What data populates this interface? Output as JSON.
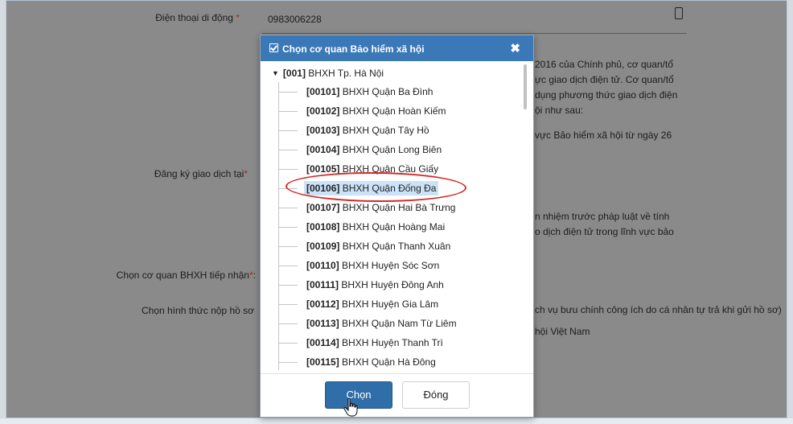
{
  "form": {
    "phone": {
      "label": "Điện thoại di động",
      "required_mark": "*",
      "value": "0983006228"
    },
    "register": {
      "label": "Đăng ký giao dịch tại",
      "required_mark": "*"
    },
    "agency": {
      "label": "Chọn cơ quan BHXH tiếp nhận",
      "required_mark": "*",
      "suffix": ":"
    },
    "submit_method": {
      "label": "Chọn hình thức nộp hồ sơ"
    }
  },
  "background_text": {
    "line1": "2016 của Chính phủ, cơ quan/tổ",
    "line2": "ực giao dịch điện tử. Cơ quan/tổ",
    "line3": "dụng phương thức giao dịch điện",
    "line4": "ội như sau:",
    "line5": "vực Bảo hiểm xã hội từ ngày 26",
    "line6": "n nhiệm trước pháp luật về tính",
    "line7": "o dịch điện tử trong lĩnh vực bảo",
    "line8": "ch vụ bưu chính công ích do cá nhân tự trả khi gửi hồ sơ)",
    "line9": "hội Việt Nam"
  },
  "modal": {
    "title": "Chọn cơ quan Bảo hiểm xã hội",
    "close_symbol": "✖",
    "root": {
      "code": "[001]",
      "name": "BHXH Tp. Hà Nội"
    },
    "items": [
      {
        "code": "[00101]",
        "name": "BHXH Quận Ba Đình"
      },
      {
        "code": "[00102]",
        "name": "BHXH Quận Hoàn Kiếm"
      },
      {
        "code": "[00103]",
        "name": "BHXH Quận Tây Hồ"
      },
      {
        "code": "[00104]",
        "name": "BHXH Quận Long Biên"
      },
      {
        "code": "[00105]",
        "name": "BHXH Quận Cầu Giấy"
      },
      {
        "code": "[00106]",
        "name": "BHXH Quận Đống Đa"
      },
      {
        "code": "[00107]",
        "name": "BHXH Quận Hai Bà Trưng"
      },
      {
        "code": "[00108]",
        "name": "BHXH Quận Hoàng Mai"
      },
      {
        "code": "[00109]",
        "name": "BHXH Quận Thanh Xuân"
      },
      {
        "code": "[00110]",
        "name": "BHXH Huyện Sóc Sơn"
      },
      {
        "code": "[00111]",
        "name": "BHXH Huyện Đông Anh"
      },
      {
        "code": "[00112]",
        "name": "BHXH Huyện Gia Lâm"
      },
      {
        "code": "[00113]",
        "name": "BHXH Quận Nam Từ Liêm"
      },
      {
        "code": "[00114]",
        "name": "BHXH Huyện Thanh Trì"
      },
      {
        "code": "[00115]",
        "name": "BHXH Quận Hà Đông"
      }
    ],
    "selected_index": 5,
    "buttons": {
      "choose": "Chọn",
      "close": "Đóng"
    }
  },
  "colors": {
    "header_bg": "#3a78b8",
    "primary_button": "#2f6ea8",
    "selection_bg": "#cbe2f8",
    "annotation": "#d42b2b",
    "overlay": "#8a8a8a"
  }
}
